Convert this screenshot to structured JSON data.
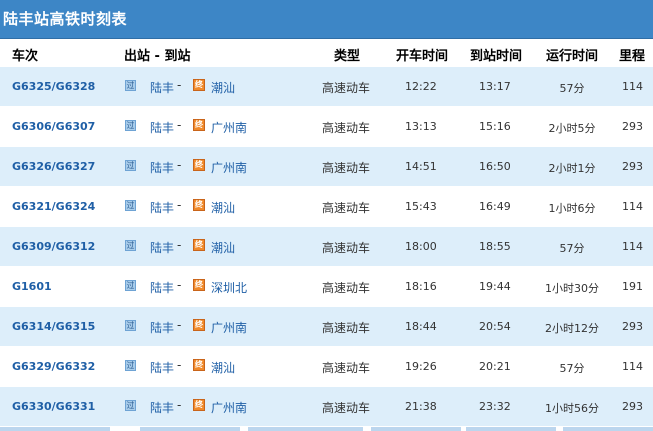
{
  "title": "陆丰站高铁时刻表",
  "headers": {
    "train": "车次",
    "route": "出站 - 到站",
    "type": "类型",
    "depart": "开车时间",
    "arrive": "到站时间",
    "duration": "运行时间",
    "distance": "里程"
  },
  "icons": {
    "pass": "过",
    "terminal": "终"
  },
  "dash": "-",
  "rows": [
    {
      "train": "G6325/G6328",
      "from": "陆丰",
      "to": "潮汕",
      "type": "高速动车",
      "depart": "12:22",
      "arrive": "13:17",
      "duration": "57分",
      "distance": "114"
    },
    {
      "train": "G6306/G6307",
      "from": "陆丰",
      "to": "广州南",
      "type": "高速动车",
      "depart": "13:13",
      "arrive": "15:16",
      "duration": "2小时5分",
      "distance": "293"
    },
    {
      "train": "G6326/G6327",
      "from": "陆丰",
      "to": "广州南",
      "type": "高速动车",
      "depart": "14:51",
      "arrive": "16:50",
      "duration": "2小时1分",
      "distance": "293"
    },
    {
      "train": "G6321/G6324",
      "from": "陆丰",
      "to": "潮汕",
      "type": "高速动车",
      "depart": "15:43",
      "arrive": "16:49",
      "duration": "1小时6分",
      "distance": "114"
    },
    {
      "train": "G6309/G6312",
      "from": "陆丰",
      "to": "潮汕",
      "type": "高速动车",
      "depart": "18:00",
      "arrive": "18:55",
      "duration": "57分",
      "distance": "114"
    },
    {
      "train": "G1601",
      "from": "陆丰",
      "to": "深圳北",
      "type": "高速动车",
      "depart": "18:16",
      "arrive": "19:44",
      "duration": "1小时30分",
      "distance": "191"
    },
    {
      "train": "G6314/G6315",
      "from": "陆丰",
      "to": "广州南",
      "type": "高速动车",
      "depart": "18:44",
      "arrive": "20:54",
      "duration": "2小时12分",
      "distance": "293"
    },
    {
      "train": "G6329/G6332",
      "from": "陆丰",
      "to": "潮汕",
      "type": "高速动车",
      "depart": "19:26",
      "arrive": "20:21",
      "duration": "57分",
      "distance": "114"
    },
    {
      "train": "G6330/G6331",
      "from": "陆丰",
      "to": "广州南",
      "type": "高速动车",
      "depart": "21:38",
      "arrive": "23:32",
      "duration": "1小时56分",
      "distance": "293"
    }
  ]
}
